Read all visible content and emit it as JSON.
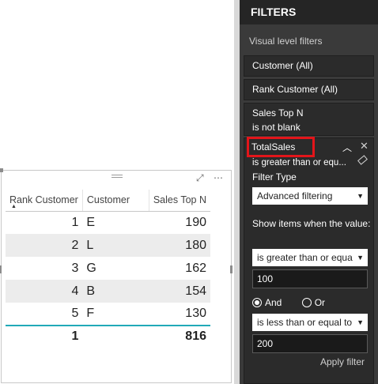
{
  "table": {
    "columns": [
      "Rank Customer",
      "Customer",
      "Sales Top N"
    ],
    "rows": [
      {
        "rank": "1",
        "customer": "E",
        "sales": "190"
      },
      {
        "rank": "2",
        "customer": "L",
        "sales": "180"
      },
      {
        "rank": "3",
        "customer": "G",
        "sales": "162"
      },
      {
        "rank": "4",
        "customer": "B",
        "sales": "154"
      },
      {
        "rank": "5",
        "customer": "F",
        "sales": "130"
      }
    ],
    "total": {
      "rank": "1",
      "customer": "",
      "sales": "816"
    }
  },
  "filters": {
    "title": "FILTERS",
    "section": "Visual level filters",
    "cards": [
      {
        "field": "Customer",
        "state": "(All)"
      },
      {
        "field": "Rank Customer",
        "state": "(All)"
      },
      {
        "field": "Sales Top N",
        "state": "is not blank"
      }
    ],
    "expanded": {
      "field": "TotalSales",
      "summary": "is greater than or equ...",
      "filter_type_label": "Filter Type",
      "filter_type_value": "Advanced filtering",
      "show_items_label": "Show items when the value:",
      "condition1": "is greater than or equa",
      "value1": "100",
      "and_label": "And",
      "or_label": "Or",
      "logic_selected": "And",
      "condition2": "is less than or equal to",
      "value2": "200",
      "apply_label": "Apply filter"
    }
  },
  "icons": {
    "dropdown_arrow": "▼",
    "chevron_up": "︿",
    "close": "✕",
    "focus_mode": "⤢",
    "more": "⋯",
    "sort_asc": "▲"
  },
  "colors": {
    "highlight_red": "#e3151a",
    "total_line": "#21a9b8",
    "pane_bg": "#252525"
  }
}
